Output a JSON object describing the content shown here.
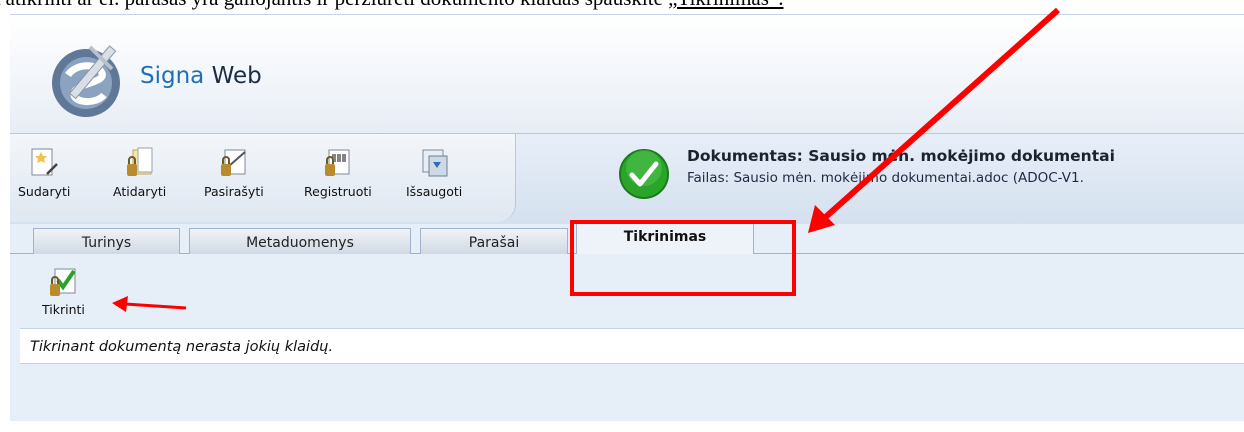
{
  "caption": {
    "text": "Patikrinti ar el. parašas yra galiojantis ir peržiūrėti dokumento klaidas spauskite ",
    "link": "„Tikrinimas“."
  },
  "app": {
    "brand_part1": "Signa",
    "brand_part2": "Web"
  },
  "toolbar": {
    "buttons": [
      {
        "label": "Sudaryti",
        "icon": "create-document-icon"
      },
      {
        "label": "Atidaryti",
        "icon": "open-folder-icon"
      },
      {
        "label": "Pasirašyti",
        "icon": "sign-document-icon"
      },
      {
        "label": "Registruoti",
        "icon": "register-document-icon"
      },
      {
        "label": "Išsaugoti",
        "icon": "save-document-icon"
      }
    ]
  },
  "document": {
    "title": "Dokumentas: Sausio mėn. mokėjimo dokumentai",
    "file": "Failas: Sausio mėn. mokėjimo dokumentai.adoc (ADOC-V1.",
    "status_icon": "valid-check-icon"
  },
  "tabs": [
    {
      "label": "Turinys",
      "active": false
    },
    {
      "label": "Metaduomenys",
      "active": false
    },
    {
      "label": "Parašai",
      "active": false
    },
    {
      "label": "Tikrinimas",
      "active": true
    }
  ],
  "verify": {
    "button_label": "Tikrinti",
    "message": "Tikrinant dokumentą nerasta jokių klaidų."
  },
  "colors": {
    "annotation": "#ff0000",
    "brand": "#1f6fb5",
    "status_green": "#2aa52a"
  }
}
